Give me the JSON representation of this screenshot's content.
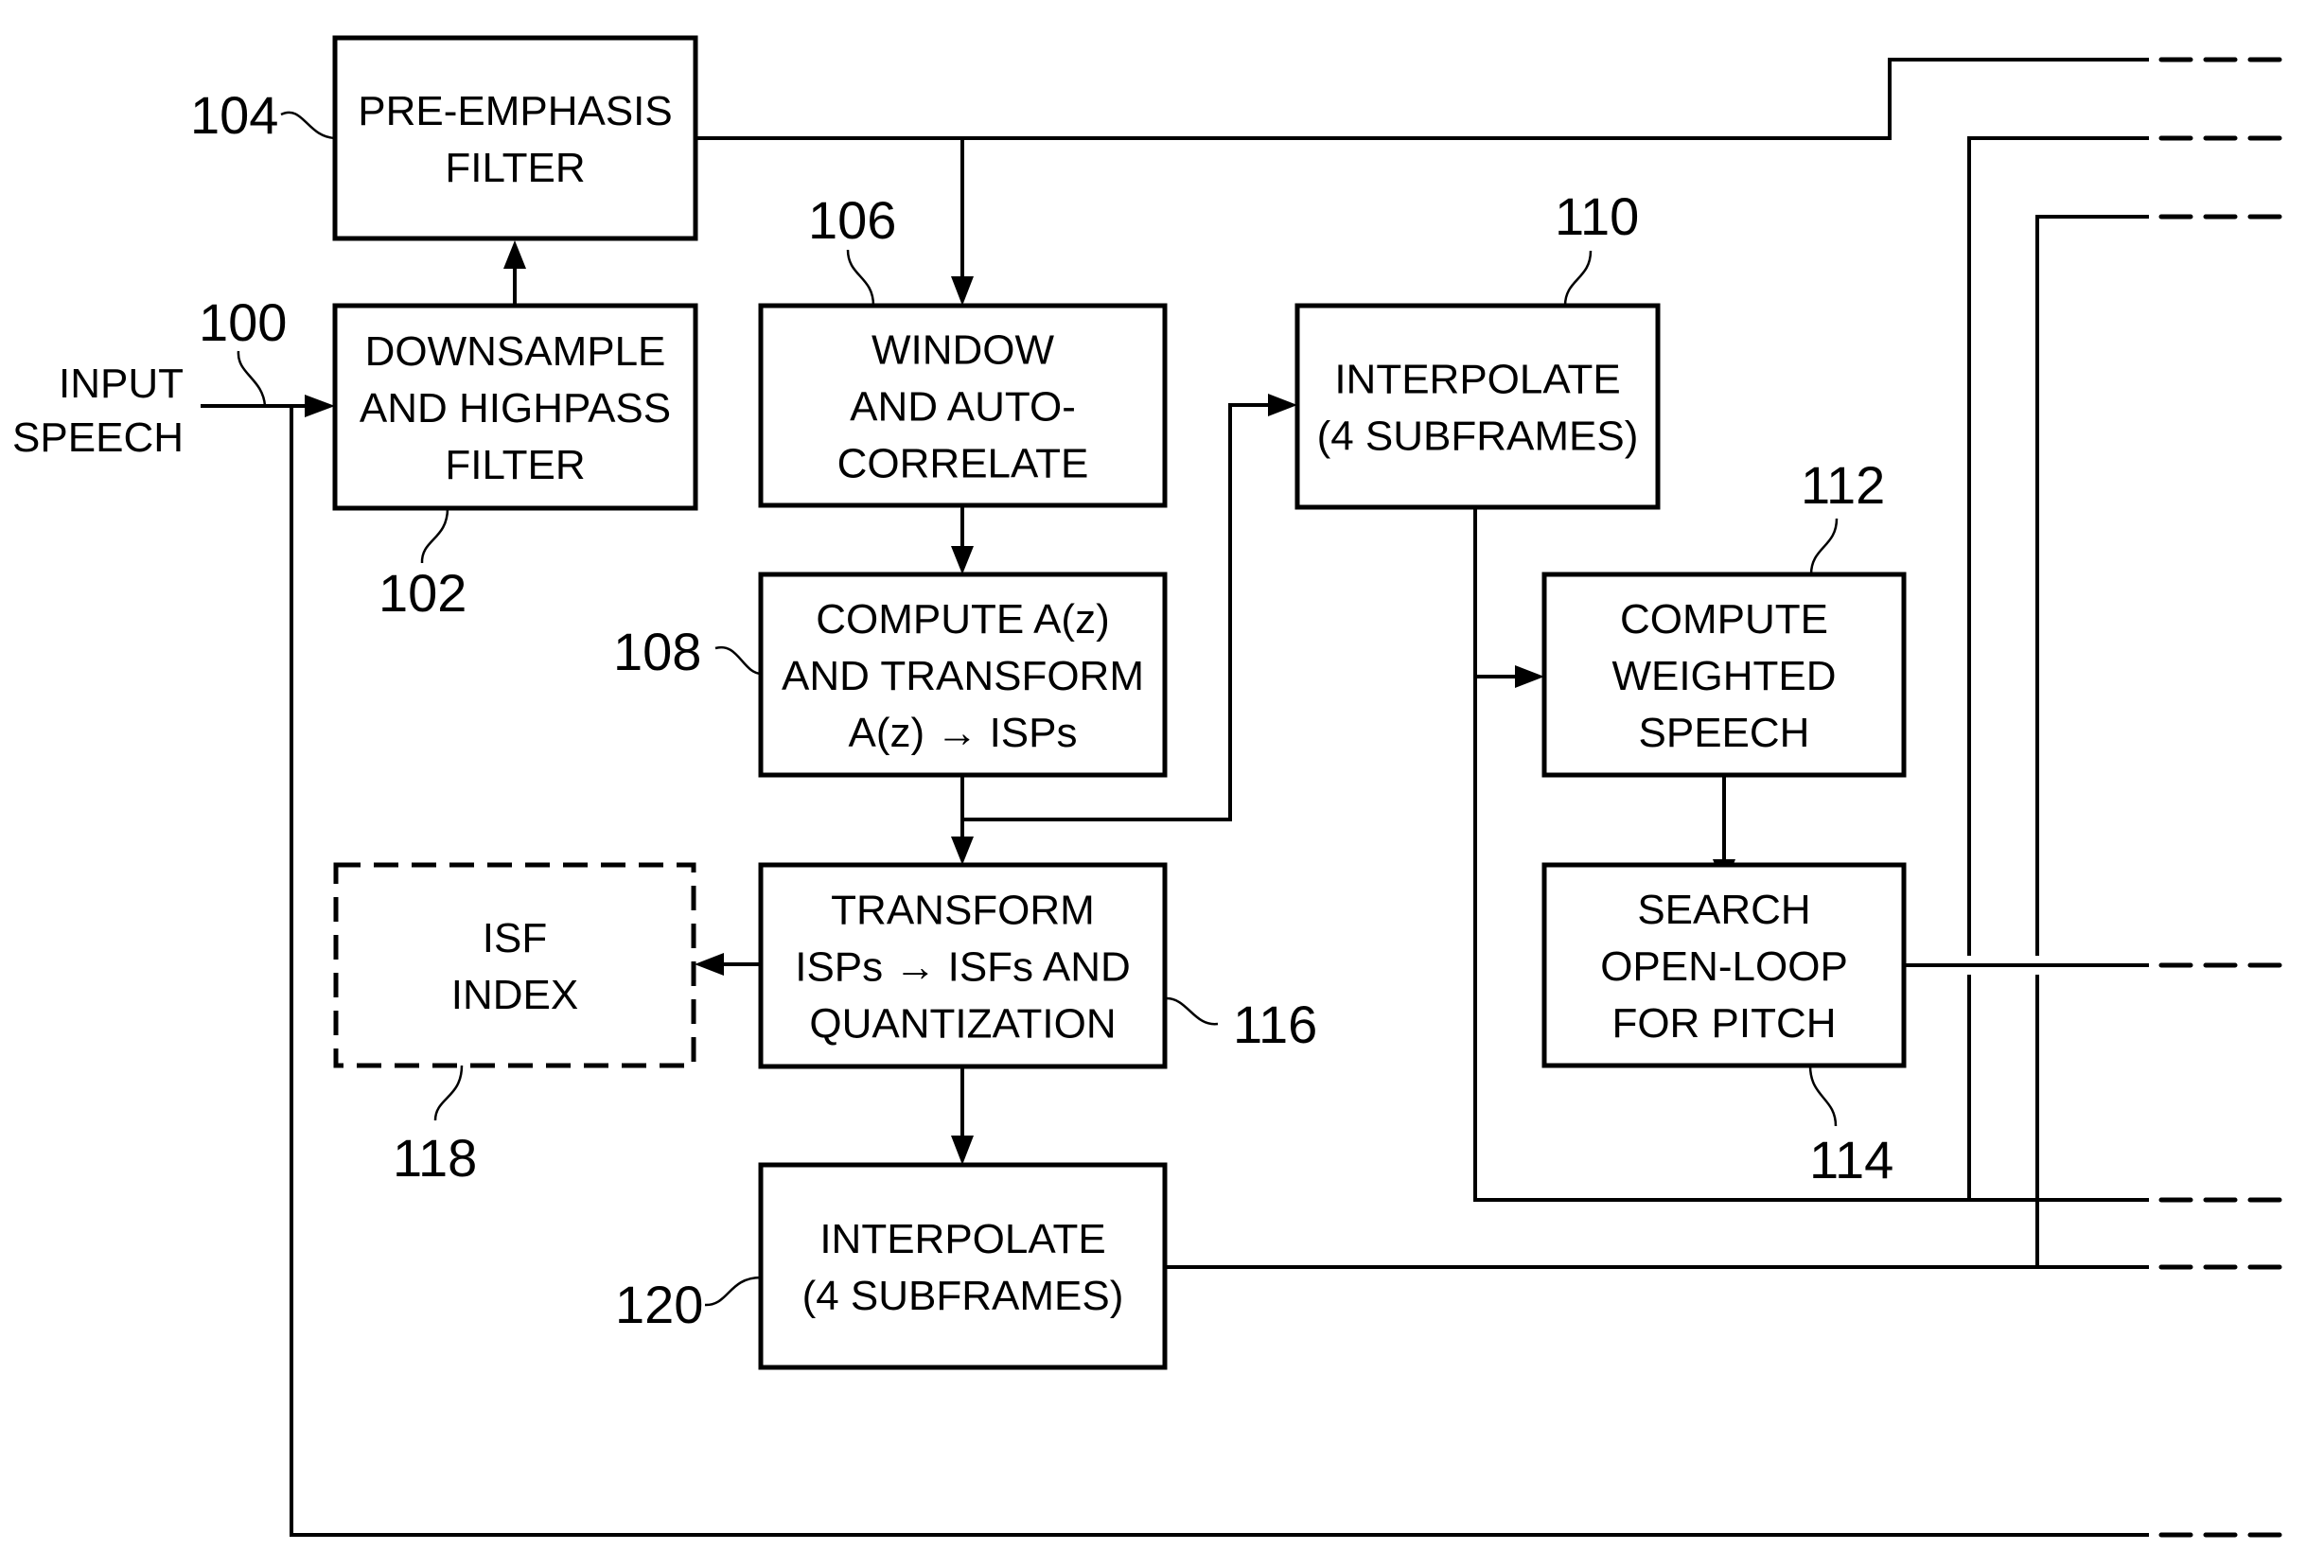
{
  "figure": {
    "input_label": [
      "INPUT",
      "SPEECH"
    ],
    "blocks": [
      {
        "id": "104",
        "ref": "104",
        "lines": [
          "PRE-EMPHASIS",
          "FILTER"
        ],
        "style": "solid"
      },
      {
        "id": "102",
        "ref": "102",
        "lines": [
          "DOWNSAMPLE",
          "AND HIGHPASS",
          "FILTER"
        ],
        "style": "solid"
      },
      {
        "id": "106",
        "ref": "106",
        "lines": [
          "WINDOW",
          "AND AUTO-",
          "CORRELATE"
        ],
        "style": "solid"
      },
      {
        "id": "108",
        "ref": "108",
        "lines": [
          "COMPUTE A(z)",
          "AND TRANSFORM",
          "A(z) → ISPs"
        ],
        "style": "solid"
      },
      {
        "id": "110",
        "ref": "110",
        "lines": [
          "INTERPOLATE",
          "(4 SUBFRAMES)"
        ],
        "style": "solid"
      },
      {
        "id": "112",
        "ref": "112",
        "lines": [
          "COMPUTE",
          "WEIGHTED",
          "SPEECH"
        ],
        "style": "solid"
      },
      {
        "id": "114",
        "ref": "114",
        "lines": [
          "SEARCH",
          "OPEN-LOOP",
          "FOR PITCH"
        ],
        "style": "solid"
      },
      {
        "id": "116",
        "ref": "116",
        "lines": [
          "TRANSFORM",
          "ISPs → ISFs AND",
          "QUANTIZATION"
        ],
        "style": "solid"
      },
      {
        "id": "118",
        "ref": "118",
        "lines": [
          "ISF",
          "INDEX"
        ],
        "style": "dashed"
      },
      {
        "id": "120",
        "ref": "120",
        "lines": [
          "INTERPOLATE",
          "(4 SUBFRAMES)"
        ],
        "style": "solid"
      }
    ],
    "input_ref": "100",
    "connections": [
      {
        "from": "input",
        "to": "102"
      },
      {
        "from": "102",
        "to": "104"
      },
      {
        "from": "104",
        "to": "106"
      },
      {
        "from": "104",
        "to": "continues-right"
      },
      {
        "from": "106",
        "to": "108"
      },
      {
        "from": "108",
        "to": "116"
      },
      {
        "from": "108",
        "to": "110"
      },
      {
        "from": "110",
        "to": "112"
      },
      {
        "from": "110",
        "to": "continues-right"
      },
      {
        "from": "112",
        "to": "114"
      },
      {
        "from": "114",
        "to": "continues-right"
      },
      {
        "from": "116",
        "to": "118"
      },
      {
        "from": "116",
        "to": "120"
      },
      {
        "from": "120",
        "to": "continues-right"
      },
      {
        "from": "input",
        "to": "continues-right"
      }
    ],
    "continuation_lines": 7
  }
}
